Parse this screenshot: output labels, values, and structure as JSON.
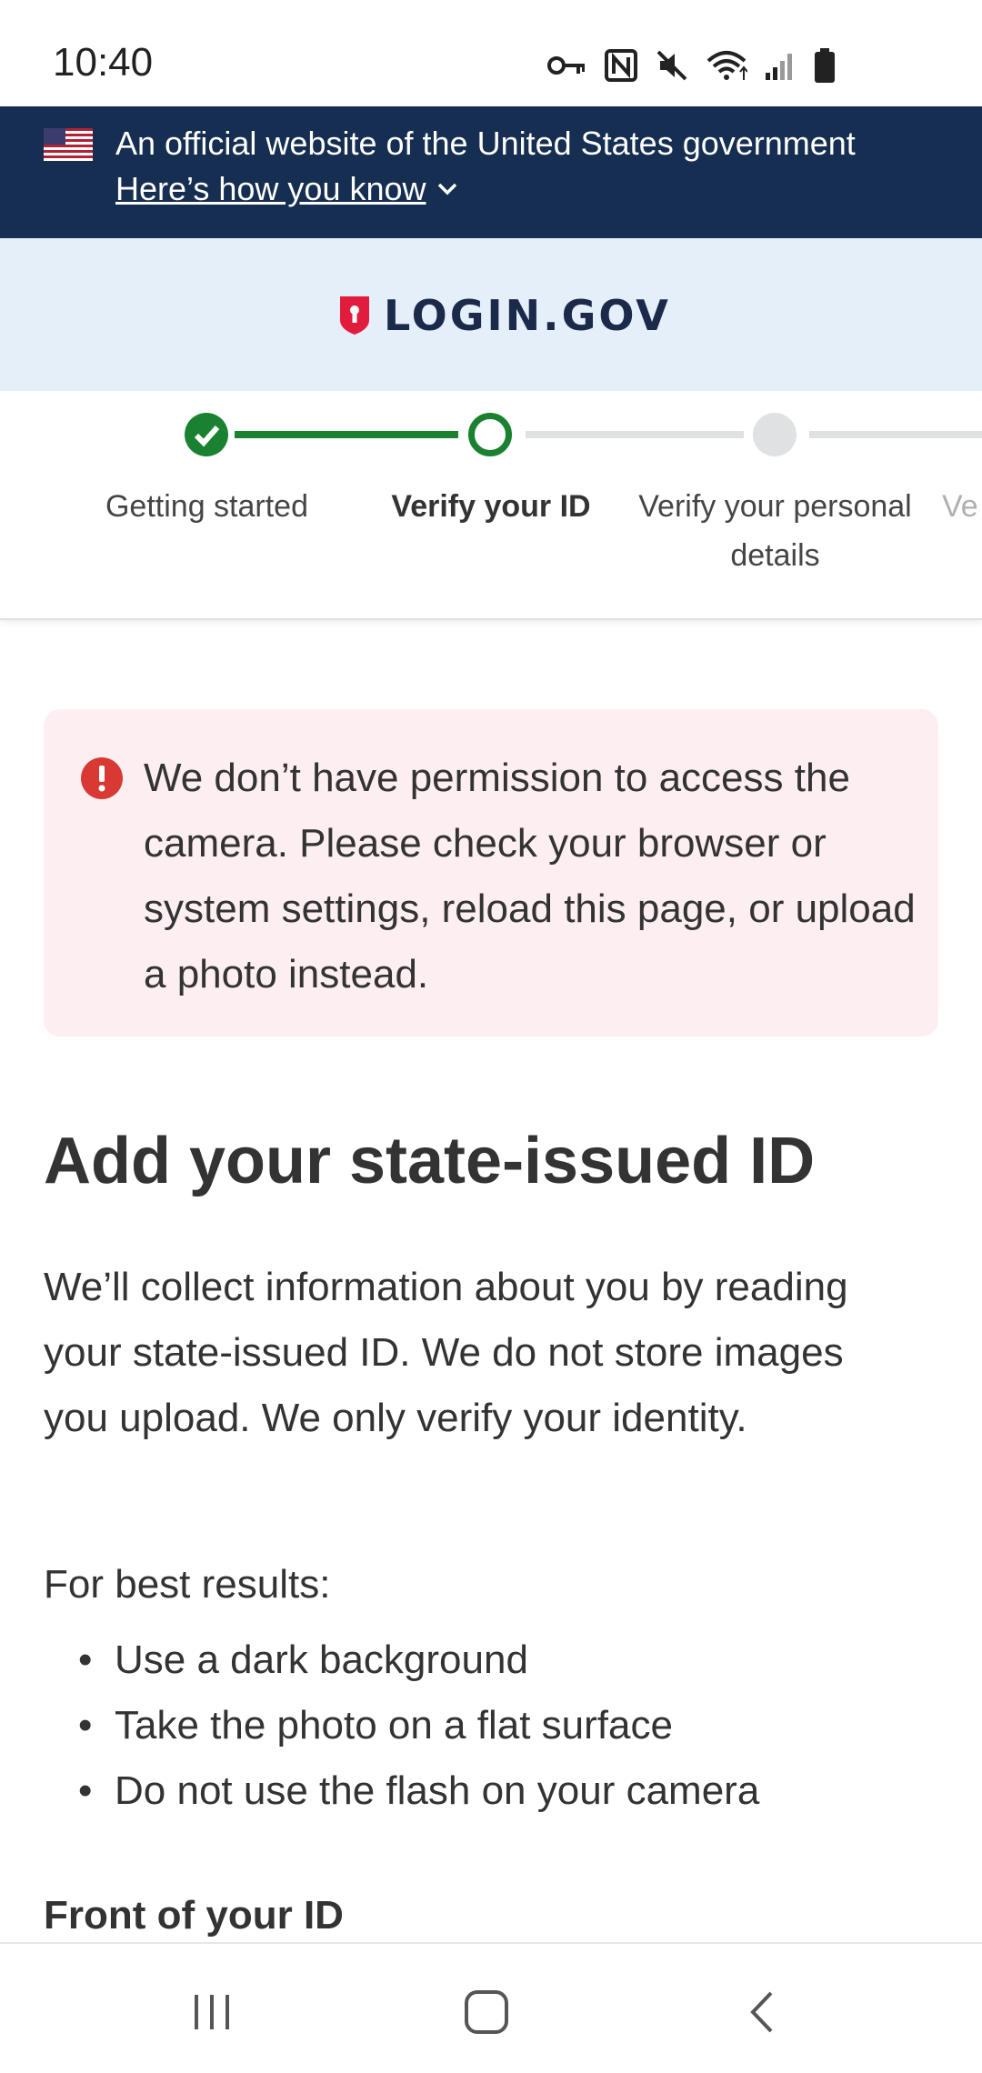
{
  "status_bar": {
    "time": "10:40",
    "icons": [
      "key-icon",
      "nfc-icon",
      "mute-icon",
      "wifi-icon",
      "signal-icon",
      "battery-icon"
    ]
  },
  "gov_banner": {
    "title": "An official website of the United States government",
    "link": "Here’s how you know"
  },
  "header": {
    "logo_text": "LOGIN.GOV"
  },
  "steps": {
    "items": [
      {
        "label": "Getting started",
        "state": "complete"
      },
      {
        "label": "Verify your ID",
        "state": "current"
      },
      {
        "label": "Verify your personal details",
        "state": "upcoming"
      },
      {
        "label": "Ve",
        "state": "upcoming"
      }
    ]
  },
  "alert": {
    "message": "We don’t have permission to access the camera. Please check your browser or system settings, reload this page, or upload a photo instead."
  },
  "main": {
    "title": "Add your state-issued ID",
    "intro": "We’ll collect information about you by reading your state-issued ID. We do not store images you upload. We only verify your identity.",
    "tips_heading": "For best results:",
    "tips": [
      "Use a dark background",
      "Take the photo on a flat surface",
      "Do not use the flash on your camera"
    ],
    "front_label": "Front of your ID"
  },
  "colors": {
    "banner_bg": "#162e51",
    "header_bg": "#e5eff9",
    "step_complete": "#1a8130",
    "step_upcoming": "#dfe1e2",
    "alert_bg": "#fdeef1",
    "error_red": "#d83933"
  }
}
